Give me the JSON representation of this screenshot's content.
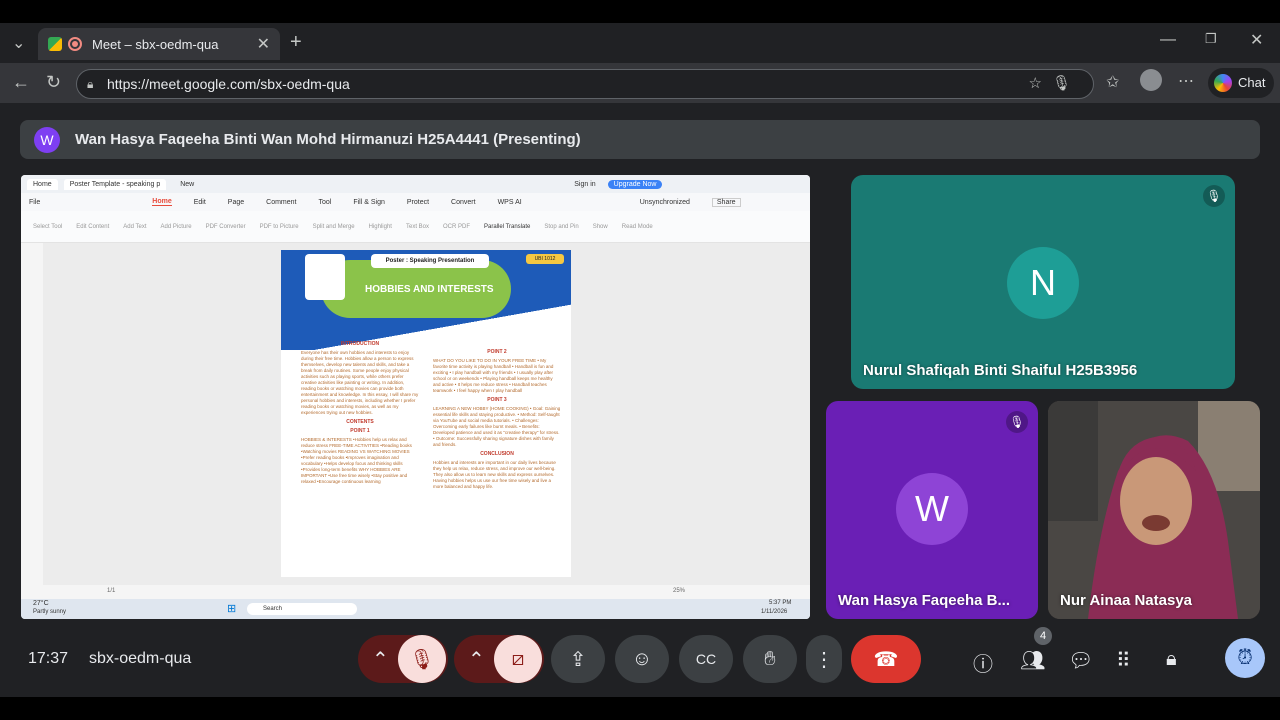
{
  "browser": {
    "tab_title": "Meet – sbx-oedm-qua",
    "url": "https://meet.google.com/sbx-oedm-qua",
    "chat_label": "Chat"
  },
  "meeting": {
    "presenter_banner": "Wan Hasya Faqeeha Binti Wan Mohd Hirmanuzi H25A4441 (Presenting)",
    "presenter_initial": "W",
    "clock": "17:37",
    "meeting_code": "sbx-oedm-qua",
    "participant_count": "4"
  },
  "participants": [
    {
      "initial": "N",
      "name": "Nurul Shafiqah Binti Shaiful H25B3956",
      "color": "#1a7a73",
      "avatar_color": "#1e9e96",
      "muted": true
    },
    {
      "initial": "W",
      "name": "Wan Hasya Faqeeha B...",
      "color": "#6a1fb5",
      "avatar_color": "#8e44d6",
      "muted": true
    },
    {
      "initial": "",
      "name": "Nur Ainaa Natasya",
      "muted": false
    }
  ],
  "shared_screen": {
    "wps_tabs": [
      "Home",
      "Poster Template - speaking p",
      "New"
    ],
    "wps_sign_in": "Sign in",
    "wps_upgrade": "Upgrade Now",
    "wps_menu": [
      "File",
      "Home",
      "Edit",
      "Page",
      "Comment",
      "Tool",
      "Fill & Sign",
      "Protect",
      "Convert",
      "WPS AI"
    ],
    "wps_unsync": "Unsynchronized",
    "wps_share": "Share",
    "wps_tools": [
      "Select Tool",
      "Edit Content",
      "Add Text",
      "Add Picture",
      "PDF Converter",
      "PDF to Picture",
      "Split and Merge",
      "Highlight",
      "Text Box",
      "OCR PDF",
      "Parallel Translate",
      "Stop and Pin",
      "Show",
      "Read Mode"
    ],
    "poster": {
      "pill": "Poster : Speaking Presentation",
      "code": "UBI 1012",
      "title": "HOBBIES AND INTERESTS",
      "intro_heading": "INTRODUCTION",
      "intro_text": "Everyone has their own hobbies and interests to enjoy during their free time. Hobbies allow a person to express themselves, develop new talents and skills, and take a break from daily routines. Some people enjoy physical activities such as playing sports, while others prefer creative activities like painting or writing. In addition, reading books or watching movies can provide both entertainment and knowledge. In this essay, I will share my personal hobbies and interests, including whether I prefer reading books or watching movies, as well as my experiences trying out new hobbies.",
      "contents_heading": "CONTENTS",
      "point1_heading": "POINT 1",
      "point1_text": "HOBBIES & INTERESTS •Hobbies help us relax and reduce stress FREE-TIME ACTIVITIES •Reading books •Watching movies READING VS WATCHING MOVIES •Prefer reading books •Improves imagination and vocabulary •Helps develop focus and thinking skills •Provides long-term benefits WHY HOBBIES ARE IMPORTANT •Use free time wisely •Stay positive and relaxed •Encourage continuous learning",
      "point2_heading": "POINT 2",
      "point2_text": "WHAT DO YOU LIKE TO DO IN YOUR FREE TIME • My favorite time activity is playing handball • Handball is fun and exciting • I play handball with my friends • I usually play after school or on weekends • Playing handball keeps me healthy and active • It helps me reduce stress • Handball teaches teamwork • I feel happy when I play handball",
      "point3_heading": "POINT 3",
      "point3_text": "LEARNING A NEW HOBBY (HOME COOKING) • Goal: Gaining essential life skills and staying productive. • Method: Self-taught via YouTube and social media tutorials. • Challenges: Overcoming early failures like burnt meals. • Benefits: Developed patience and used it as \"creative therapy\" for stress. • Outcome: Successfully sharing signature dishes with family and friends.",
      "conclusion_heading": "CONCLUSION",
      "conclusion_text": "Hobbies and interests are important in our daily lives because they help us relax, reduce stress, and improve our well-being. They also allow us to learn new skills and express ourselves. Having hobbies helps us use our free time wisely and live a more balanced and happy life."
    },
    "page_indicator": "1/1",
    "zoom": "25%",
    "weather_temp": "27°C",
    "weather_desc": "Partly sunny",
    "taskbar_search": "Search",
    "taskbar_time": "5:37 PM",
    "taskbar_date": "1/11/2026"
  },
  "colors": {
    "meet_bg": "#202124",
    "end_call": "#dc362e",
    "accent_blue": "#a8c7fa"
  }
}
